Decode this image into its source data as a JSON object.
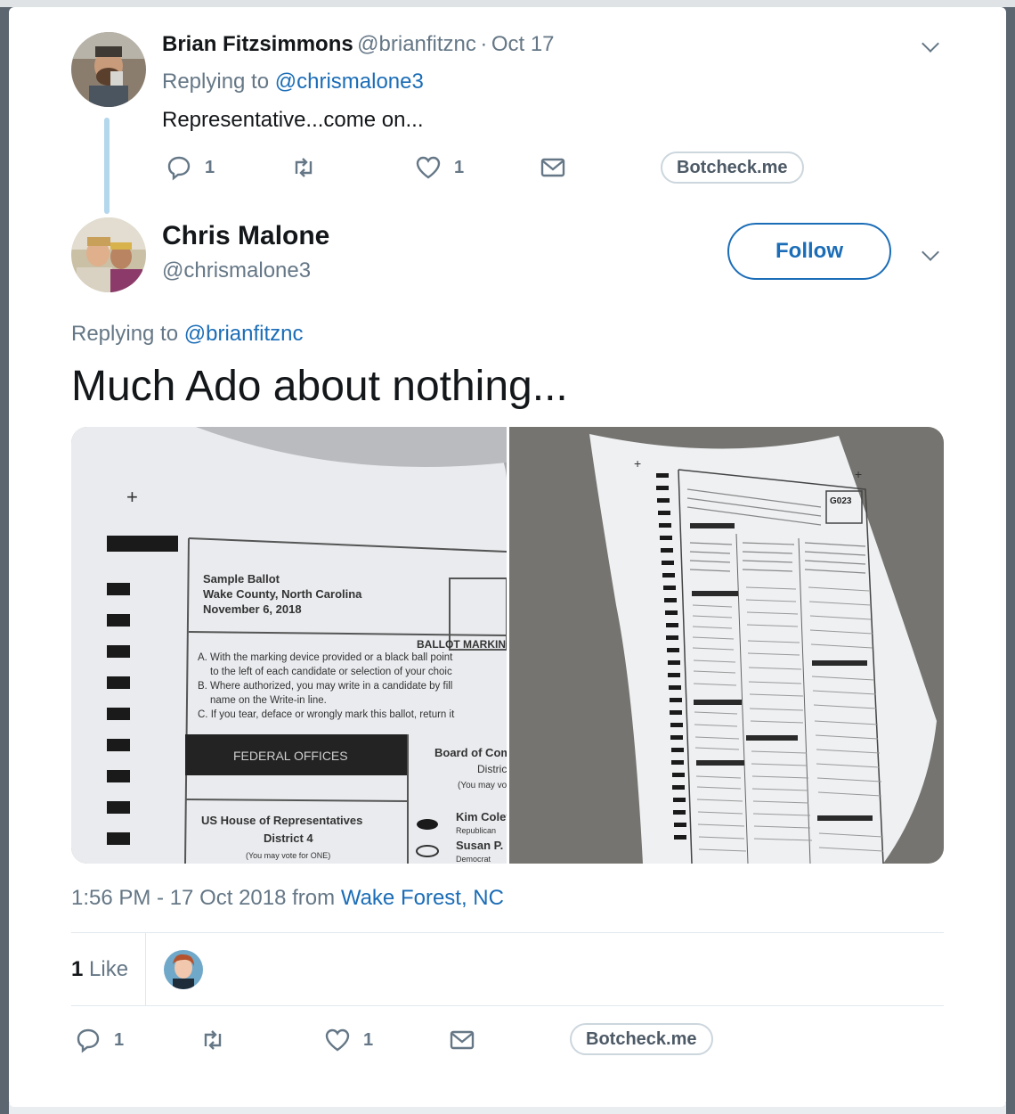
{
  "reply_tweet": {
    "name": "Brian Fitzsimmons",
    "handle": "@brianfitznc",
    "separator": "·",
    "date": "Oct 17",
    "replying_prefix": "Replying to",
    "replying_handle": "@chrismalone3",
    "text": "Representative...come on...",
    "replies": "1",
    "likes": "1",
    "botcheck": "Botcheck.me"
  },
  "main_tweet": {
    "name": "Chris Malone",
    "handle": "@chrismalone3",
    "follow_label": "Follow",
    "replying_prefix": "Replying to",
    "replying_handle": "@brianfitznc",
    "text": "Much Ado about nothing...",
    "timestamp": "1:56 PM - 17 Oct 2018 from",
    "location": "Wake Forest, NC",
    "likes_count": "1",
    "likes_label": "Like",
    "replies": "1",
    "likes": "1",
    "botcheck": "Botcheck.me"
  },
  "ballot_left": {
    "lines": [
      "Sample Ballot",
      "Wake County, North Carolina",
      "November 6, 2018"
    ],
    "marking": "BALLOT MARKING I",
    "instructions": [
      "A. With the marking device provided or a black ball point",
      "to the left of each candidate or selection of your choic",
      "B. Where authorized, you may write in a candidate by fill",
      "name on the Write-in line.",
      "C. If you tear, deface or wrongly mark this ballot, return it"
    ],
    "federal": "FEDERAL OFFICES",
    "board": "Board of Com",
    "district_line": "Distric",
    "vote": "(You may vote",
    "house": "US House of Representatives",
    "district": "District 4",
    "vote_one": "(You may vote for ONE)",
    "cand1": "Kim Coley",
    "cand1_party": "Republican",
    "cand2": "Susan P. E",
    "cand2_party": "Democrat"
  },
  "ballot_right": {
    "code": "G023"
  },
  "colors": {
    "link": "#1b6db7",
    "text": "#14171a",
    "muted": "#657786",
    "thread": "#b3d7ec"
  }
}
